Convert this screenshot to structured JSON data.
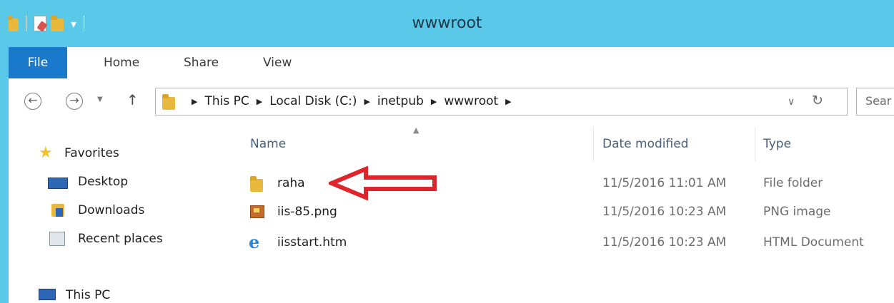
{
  "window": {
    "title": "wwwroot"
  },
  "ribbon": {
    "tabs": [
      "File",
      "Home",
      "Share",
      "View"
    ]
  },
  "address": {
    "crumbs": [
      "This PC",
      "Local Disk (C:)",
      "inetpub",
      "wwwroot"
    ],
    "search_placeholder": "Sear"
  },
  "nav": {
    "favorites": "Favorites",
    "items": [
      "Desktop",
      "Downloads",
      "Recent places"
    ],
    "this_pc": "This PC"
  },
  "columns": {
    "name": "Name",
    "date": "Date modified",
    "type": "Type"
  },
  "files": [
    {
      "name": "raha",
      "date": "11/5/2016 11:01 AM",
      "type": "File folder",
      "icon": "folder-icon"
    },
    {
      "name": "iis-85.png",
      "date": "11/5/2016 10:23 AM",
      "type": "PNG image",
      "icon": "png-file-icon"
    },
    {
      "name": "iisstart.htm",
      "date": "11/5/2016 10:23 AM",
      "type": "HTML Document",
      "icon": "internet-explorer-icon"
    }
  ],
  "colors": {
    "titlebar": "#5ac8e8",
    "file_tab": "#1979ca",
    "annotation_arrow": "#e0242b"
  }
}
